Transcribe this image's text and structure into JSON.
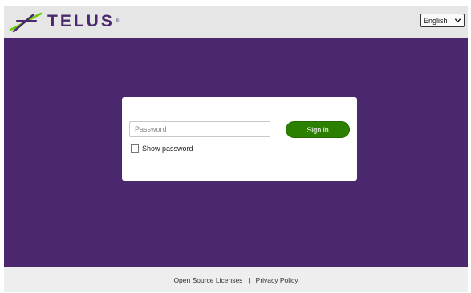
{
  "header": {
    "logo_text": "TELUS",
    "logo_trademark": "®",
    "logo_icon": "telus-swoosh-icon",
    "language_selected": "English"
  },
  "login": {
    "password_placeholder": "Password",
    "signin_label": "Sign in",
    "show_password_label": "Show password",
    "show_password_checked": false
  },
  "footer": {
    "links": [
      {
        "label": "Open Source Licenses"
      },
      {
        "label": "Privacy Policy"
      }
    ],
    "separator": "|"
  },
  "colors": {
    "brand_purple": "#4b286d",
    "signin_green": "#2b8000",
    "logo_green": "#66cc00",
    "header_gray": "#e6e6e6"
  }
}
